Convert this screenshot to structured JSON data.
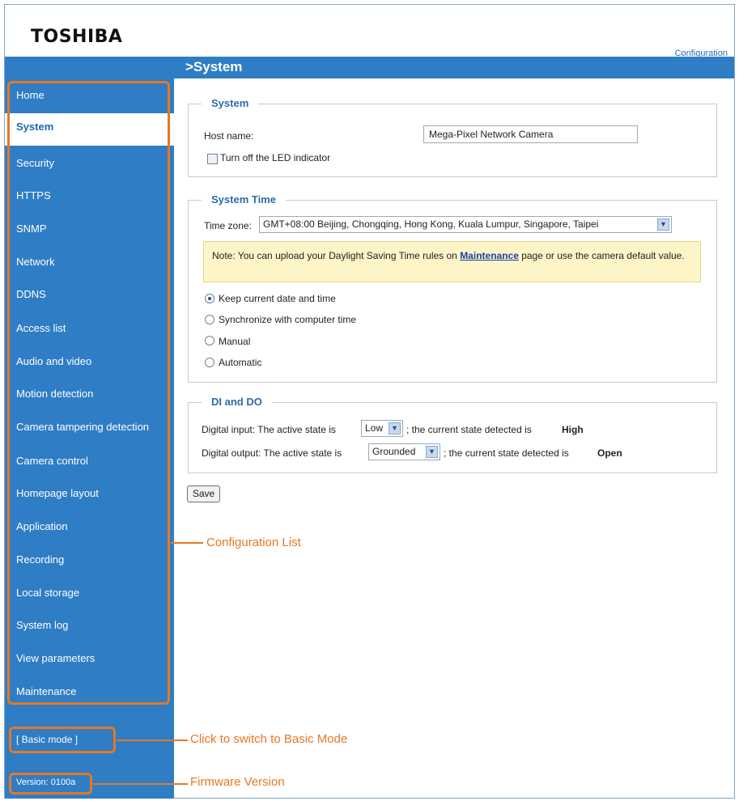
{
  "brand": "TOSHIBA",
  "header": {
    "config_link": "Configuration",
    "title": ">System"
  },
  "sidebar": {
    "items": [
      {
        "label": "Home"
      },
      {
        "label": "System"
      },
      {
        "label": "Security"
      },
      {
        "label": "HTTPS"
      },
      {
        "label": "SNMP"
      },
      {
        "label": "Network"
      },
      {
        "label": "DDNS"
      },
      {
        "label": "Access list"
      },
      {
        "label": "Audio and video"
      },
      {
        "label": "Motion detection"
      },
      {
        "label": "Camera tampering detection"
      },
      {
        "label": "Camera control"
      },
      {
        "label": "Homepage layout"
      },
      {
        "label": "Application"
      },
      {
        "label": "Recording"
      },
      {
        "label": "Local storage"
      },
      {
        "label": "System log"
      },
      {
        "label": "View parameters"
      },
      {
        "label": "Maintenance"
      }
    ],
    "active": "System",
    "basic_mode": "[ Basic mode ]",
    "version": "Version: 0100a"
  },
  "system": {
    "legend": "System",
    "host_label": "Host name:",
    "host_value": "Mega-Pixel Network Camera",
    "led_label": "Turn off the LED indicator"
  },
  "time": {
    "legend": "System Time",
    "zone_label": "Time zone:",
    "zone_value": "GMT+08:00 Beijing, Chongqing, Hong Kong, Kuala Lumpur, Singapore, Taipei",
    "note_prefix": "Note: You can upload your Daylight Saving Time rules on ",
    "note_link": "Maintenance",
    "note_suffix": " page or use the camera default value.",
    "options": [
      "Keep current date and time",
      "Synchronize with computer time",
      "Manual",
      "Automatic"
    ],
    "selected": "Keep current date and time"
  },
  "dido": {
    "legend": "DI and DO",
    "di_prefix": "Digital input: The active state is",
    "di_value": "Low",
    "di_mid": "; the current state detected is",
    "di_state": "High",
    "do_prefix": "Digital output: The active state is",
    "do_value": "Grounded",
    "do_mid": "; the current state detected is",
    "do_state": "Open"
  },
  "save_label": "Save",
  "annotations": {
    "config_list": "Configuration List",
    "basic_mode": "Click to switch to Basic Mode",
    "firmware": "Firmware Version"
  },
  "colors": {
    "sidebar": "#2f7dc4",
    "accent": "#e87722",
    "note_bg": "#fdf4c8"
  },
  "icons": {
    "select_arrow": "chevron-down-icon",
    "radio": "radio-icon",
    "checkbox": "checkbox-icon"
  }
}
